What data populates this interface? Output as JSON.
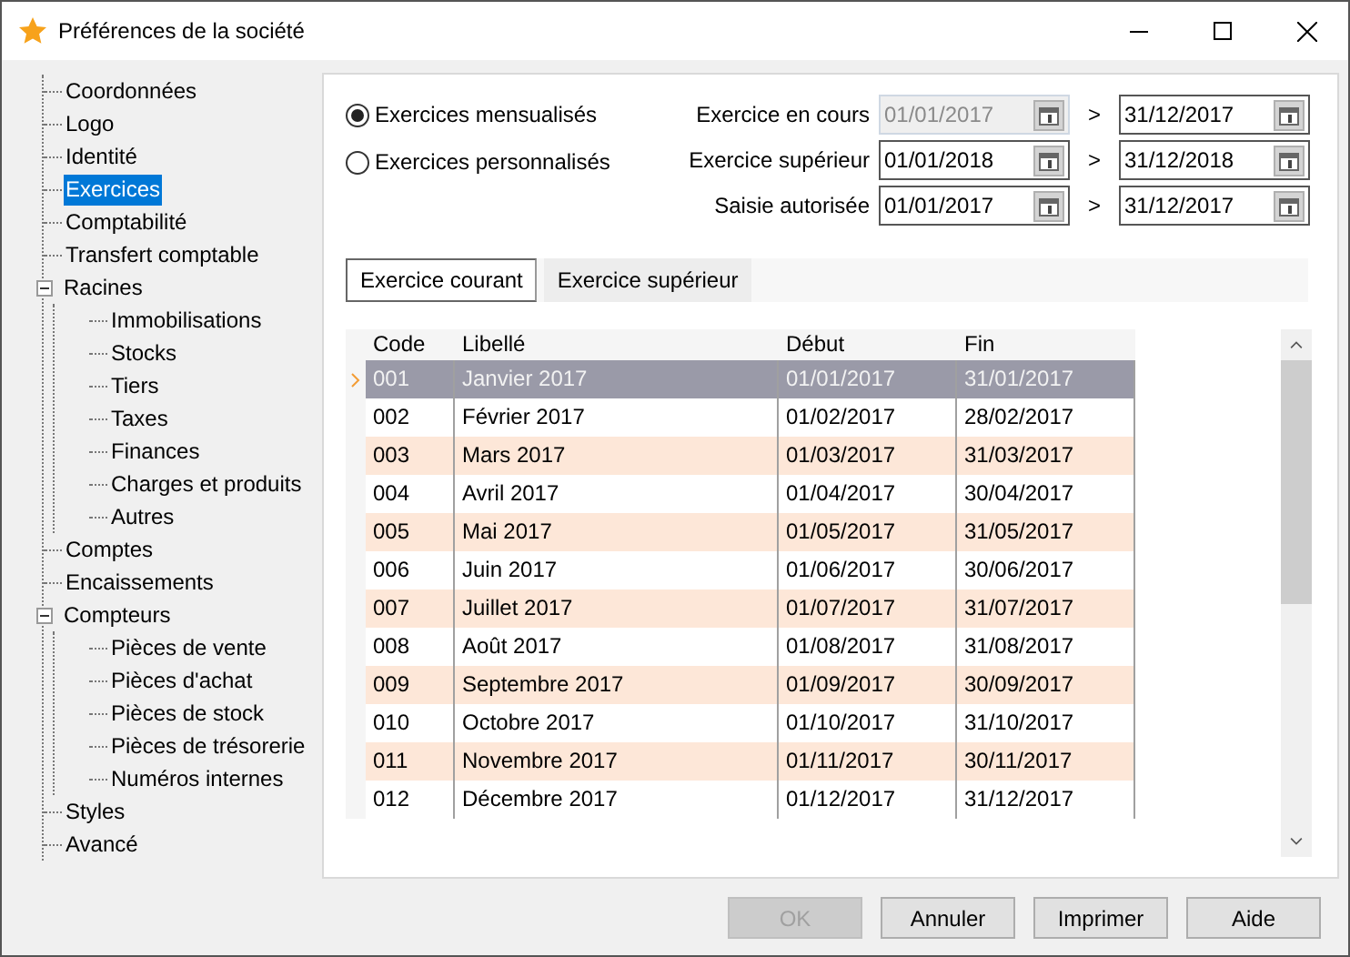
{
  "window": {
    "title": "Préférences de la société"
  },
  "tree": [
    {
      "label": "Coordonnées",
      "selected": false
    },
    {
      "label": "Logo",
      "selected": false
    },
    {
      "label": "Identité",
      "selected": false
    },
    {
      "label": "Exercices",
      "selected": true
    },
    {
      "label": "Comptabilité",
      "selected": false
    },
    {
      "label": "Transfert comptable",
      "selected": false
    },
    {
      "label": "Racines",
      "selected": false,
      "expanded": true,
      "children": [
        {
          "label": "Immobilisations",
          "selected": false
        },
        {
          "label": "Stocks",
          "selected": false
        },
        {
          "label": "Tiers",
          "selected": false
        },
        {
          "label": "Taxes",
          "selected": false
        },
        {
          "label": "Finances",
          "selected": false
        },
        {
          "label": "Charges et produits",
          "selected": false
        },
        {
          "label": "Autres",
          "selected": false
        }
      ]
    },
    {
      "label": "Comptes",
      "selected": false
    },
    {
      "label": "Encaissements",
      "selected": false
    },
    {
      "label": "Compteurs",
      "selected": false,
      "expanded": true,
      "children": [
        {
          "label": "Pièces de vente",
          "selected": false
        },
        {
          "label": "Pièces d'achat",
          "selected": false
        },
        {
          "label": "Pièces de stock",
          "selected": false
        },
        {
          "label": "Pièces de trésorerie",
          "selected": false
        },
        {
          "label": "Numéros internes",
          "selected": false
        }
      ]
    },
    {
      "label": "Styles",
      "selected": false
    },
    {
      "label": "Avancé",
      "selected": false
    }
  ],
  "radios": [
    {
      "label": "Exercices mensualisés",
      "selected": true
    },
    {
      "label": "Exercices personnalisés",
      "selected": false
    }
  ],
  "periods": [
    {
      "label": "Exercice en cours",
      "from": "01/01/2017",
      "from_disabled": true,
      "separator": ">",
      "to": "31/12/2017"
    },
    {
      "label": "Exercice supérieur",
      "from": "01/01/2018",
      "from_disabled": false,
      "separator": ">",
      "to": "31/12/2018"
    },
    {
      "label": "Saisie autorisée",
      "from": "01/01/2017",
      "from_disabled": false,
      "separator": ">",
      "to": "31/12/2017"
    }
  ],
  "tabs": [
    {
      "label": "Exercice courant",
      "selected": true
    },
    {
      "label": "Exercice supérieur",
      "selected": false
    }
  ],
  "table": {
    "columns": [
      "Code",
      "Libellé",
      "Début",
      "Fin"
    ],
    "rows": [
      {
        "cells": [
          "001",
          "Janvier 2017",
          "01/01/2017",
          "31/01/2017"
        ],
        "selected": true
      },
      {
        "cells": [
          "002",
          "Février 2017",
          "01/02/2017",
          "28/02/2017"
        ],
        "selected": false
      },
      {
        "cells": [
          "003",
          "Mars 2017",
          "01/03/2017",
          "31/03/2017"
        ],
        "selected": false
      },
      {
        "cells": [
          "004",
          "Avril 2017",
          "01/04/2017",
          "30/04/2017"
        ],
        "selected": false
      },
      {
        "cells": [
          "005",
          "Mai 2017",
          "01/05/2017",
          "31/05/2017"
        ],
        "selected": false
      },
      {
        "cells": [
          "006",
          "Juin 2017",
          "01/06/2017",
          "30/06/2017"
        ],
        "selected": false
      },
      {
        "cells": [
          "007",
          "Juillet 2017",
          "01/07/2017",
          "31/07/2017"
        ],
        "selected": false
      },
      {
        "cells": [
          "008",
          "Août 2017",
          "01/08/2017",
          "31/08/2017"
        ],
        "selected": false
      },
      {
        "cells": [
          "009",
          "Septembre 2017",
          "01/09/2017",
          "30/09/2017"
        ],
        "selected": false
      },
      {
        "cells": [
          "010",
          "Octobre 2017",
          "01/10/2017",
          "31/10/2017"
        ],
        "selected": false
      },
      {
        "cells": [
          "011",
          "Novembre 2017",
          "01/11/2017",
          "30/11/2017"
        ],
        "selected": false
      },
      {
        "cells": [
          "012",
          "Décembre 2017",
          "01/12/2017",
          "31/12/2017"
        ],
        "selected": false
      }
    ]
  },
  "buttons": [
    {
      "label": "OK",
      "disabled": true
    },
    {
      "label": "Annuler",
      "disabled": false
    },
    {
      "label": "Imprimer",
      "disabled": false
    },
    {
      "label": "Aide",
      "disabled": false
    }
  ]
}
